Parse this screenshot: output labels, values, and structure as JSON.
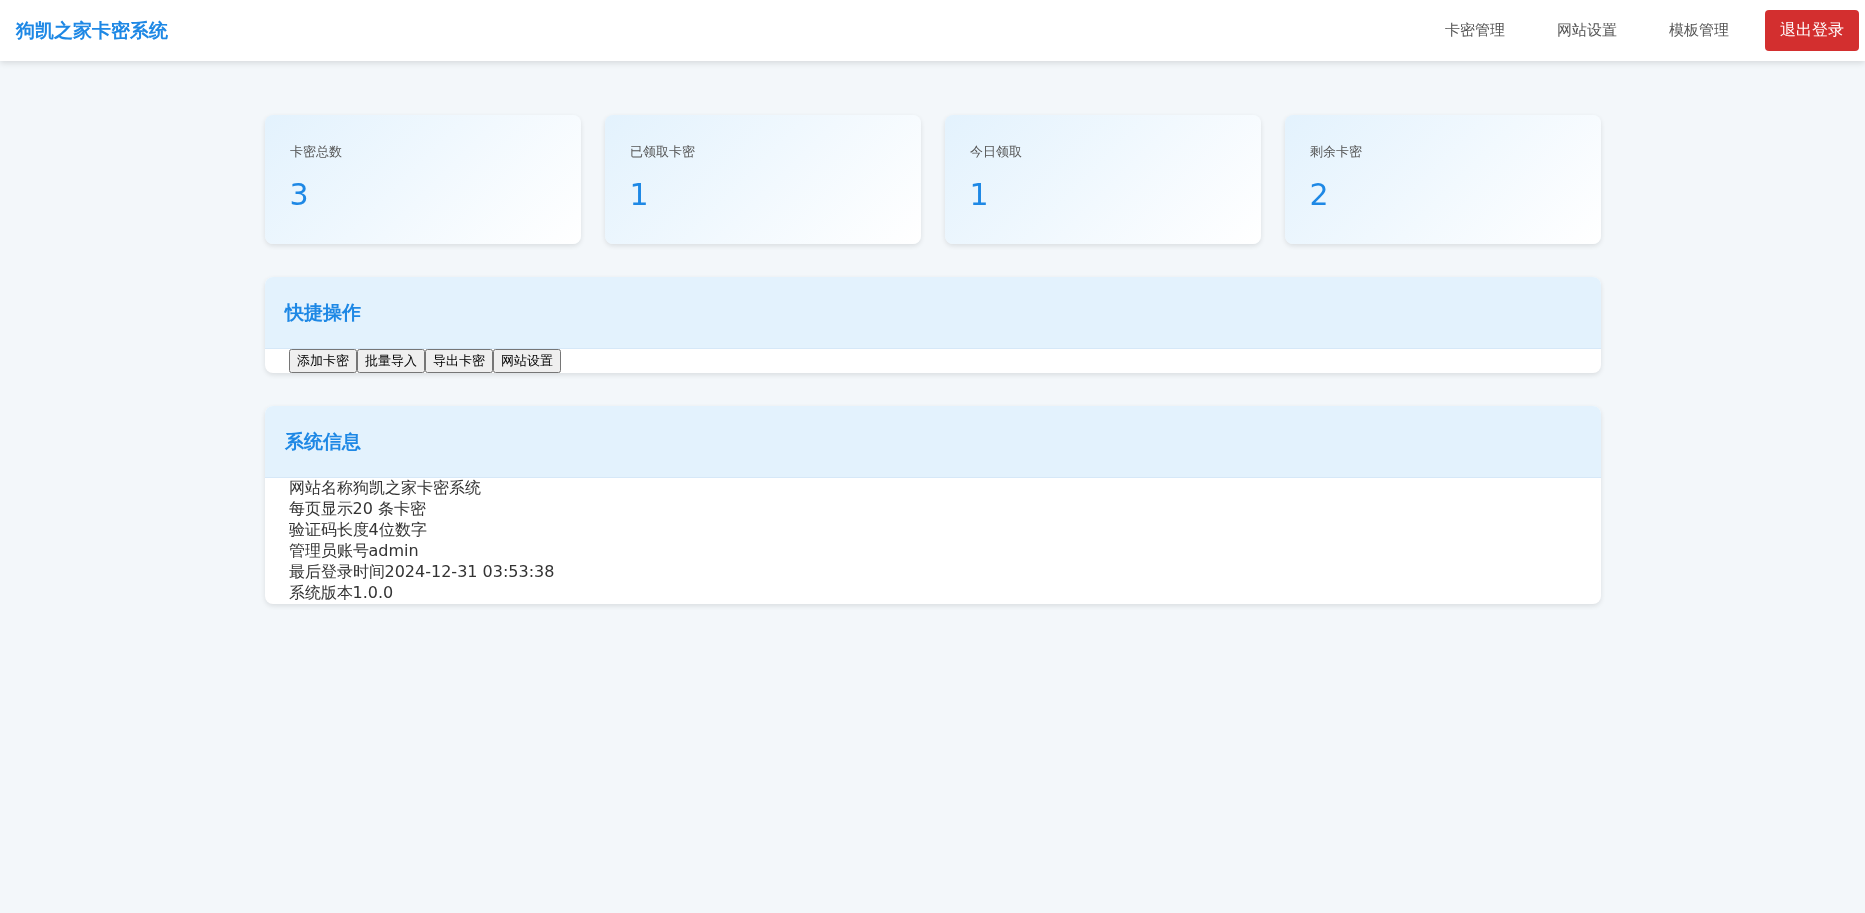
{
  "header": {
    "title": "狗凯之家卡密系统",
    "nav": [
      {
        "label": "卡密管理",
        "kind": "link"
      },
      {
        "label": "网站设置",
        "kind": "link"
      },
      {
        "label": "模板管理",
        "kind": "link"
      },
      {
        "label": "退出登录",
        "kind": "danger"
      }
    ]
  },
  "stats": [
    {
      "label": "卡密总数",
      "value": "3"
    },
    {
      "label": "已领取卡密",
      "value": "1"
    },
    {
      "label": "今日领取",
      "value": "1"
    },
    {
      "label": "剩余卡密",
      "value": "2"
    }
  ],
  "quick_actions": {
    "title": "快捷操作",
    "buttons": [
      "添加卡密",
      "批量导入",
      "导出卡密",
      "网站设置"
    ]
  },
  "system_info": {
    "title": "系统信息",
    "rows": [
      {
        "label": "网站名称",
        "value": "狗凯之家卡密系统"
      },
      {
        "label": "每页显示",
        "value": "20 条卡密"
      },
      {
        "label": "验证码长度",
        "value": "4位数字"
      },
      {
        "label": "管理员账号",
        "value": "admin"
      },
      {
        "label": "最后登录时间",
        "value": "2024-12-31 03:53:38"
      },
      {
        "label": "系统版本",
        "value": "1.0.0"
      }
    ]
  }
}
